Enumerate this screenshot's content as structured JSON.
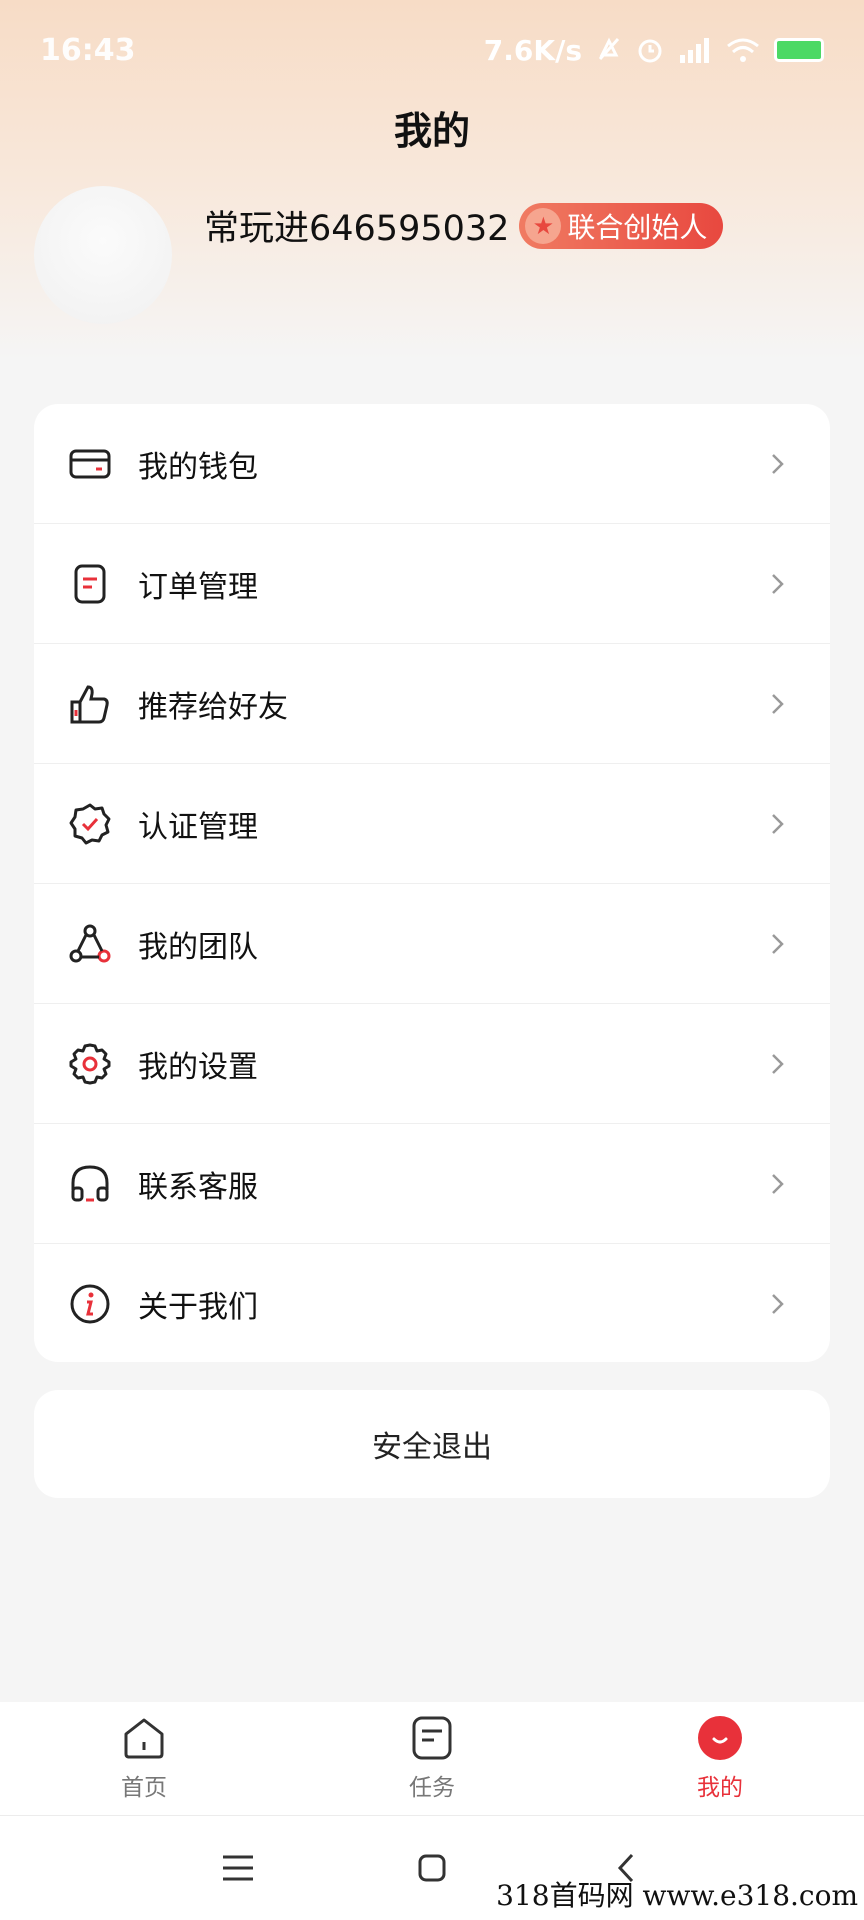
{
  "status_bar": {
    "time": "16:43",
    "net_speed": "7.6K/s",
    "icons": [
      "mute-icon",
      "alarm-icon",
      "signal-icon",
      "wifi-icon",
      "battery-icon"
    ]
  },
  "header": {
    "title": "我的"
  },
  "profile": {
    "username": "常玩进646595032",
    "badge_label": "联合创始人"
  },
  "menu": {
    "items": [
      {
        "label": "我的钱包",
        "icon": "wallet-icon"
      },
      {
        "label": "订单管理",
        "icon": "order-icon"
      },
      {
        "label": "推荐给好友",
        "icon": "thumbs-up-icon"
      },
      {
        "label": "认证管理",
        "icon": "verified-icon"
      },
      {
        "label": "我的团队",
        "icon": "team-icon"
      },
      {
        "label": "我的设置",
        "icon": "gear-icon"
      },
      {
        "label": "联系客服",
        "icon": "headset-icon"
      },
      {
        "label": "关于我们",
        "icon": "info-icon"
      }
    ]
  },
  "logout": {
    "label": "安全退出"
  },
  "tab_bar": {
    "tabs": [
      {
        "label": "首页",
        "icon": "home-icon",
        "active": false
      },
      {
        "label": "任务",
        "icon": "task-icon",
        "active": false
      },
      {
        "label": "我的",
        "icon": "profile-icon",
        "active": true
      }
    ]
  },
  "colors": {
    "accent": "#e8313a",
    "badge_gradient_start": "#f07b62",
    "badge_gradient_end": "#e8483f",
    "header_bg": "#f7dcc6"
  },
  "watermark": "318首码网  www.e318.com"
}
